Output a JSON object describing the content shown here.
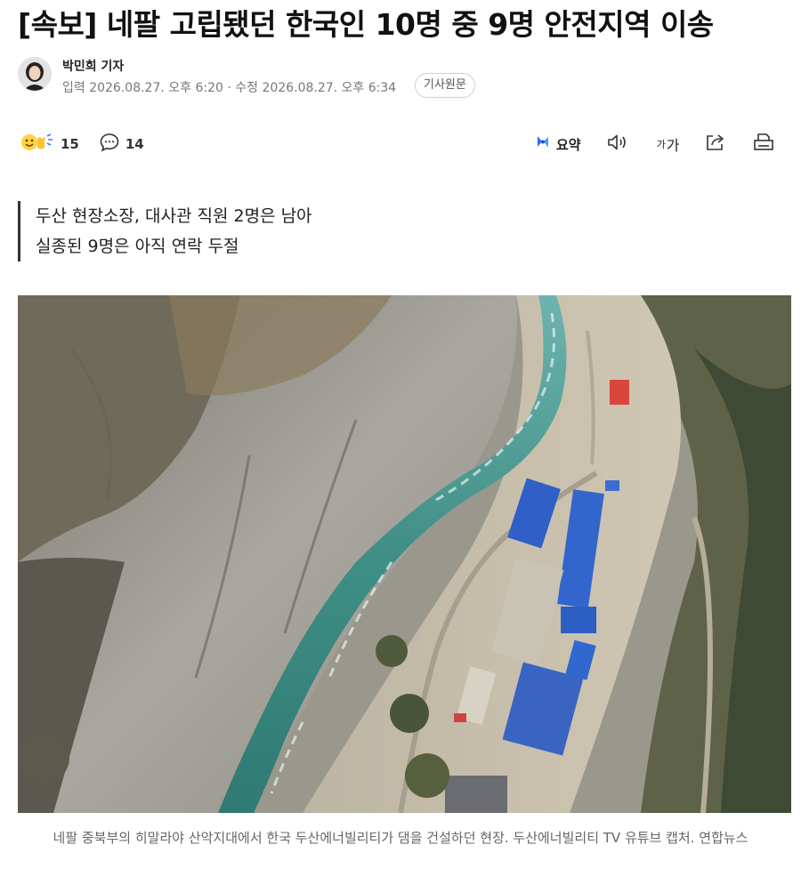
{
  "article": {
    "headline": "[속보] 네팔 고립됐던 한국인 10명 중 9명 안전지역 이송",
    "reporter": "박민희 기자",
    "published": "입력 2026.08.27. 오후 6:20",
    "separator": " · ",
    "updated": "수정 2026.08.27. 오후 6:34",
    "source_button": "기사원문",
    "subhead_lines": [
      "두산 현장소장, 대사관 직원 2명은 남아",
      "실종된 9명은 아직 연락 두절"
    ],
    "photo_caption": "네팔 중북부의 히말라야 산악지대에서 한국 두산에너빌리티가 댐을 건설하던 현장. 두산에너빌리티 TV 유튜브 캡처. 연합뉴스"
  },
  "toolbar": {
    "reaction_count": "15",
    "comment_count": "14",
    "summary_label": "요약",
    "font_label_small": "가",
    "font_label_large": "가"
  },
  "icons": {
    "reaction": "reaction-emoji-icon",
    "comment": "comment-bubble-icon",
    "summary": "ai-summary-icon",
    "audio": "speaker-icon",
    "font": "font-size-icon",
    "share": "share-icon",
    "print": "print-icon"
  },
  "colors": {
    "summary_accent": "#2f6df6",
    "river": "#3f8f86",
    "roof_blue": "#2f5fc7"
  }
}
